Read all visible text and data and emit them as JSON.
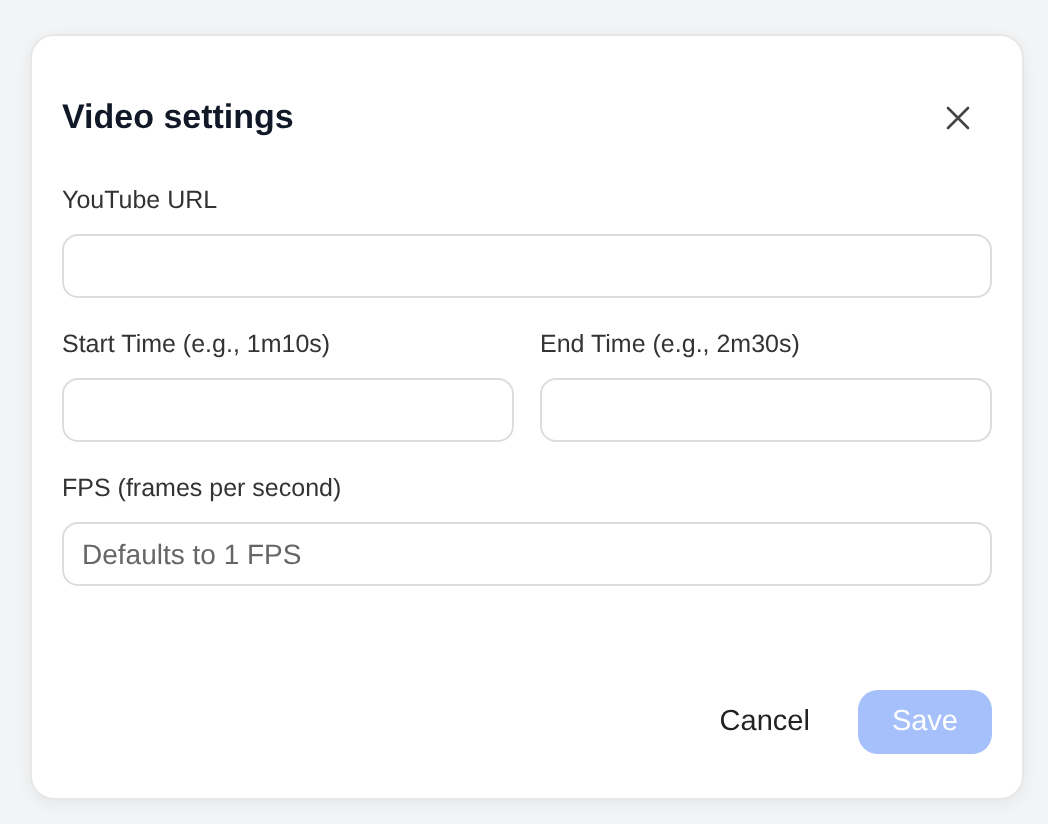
{
  "dialog": {
    "title": "Video settings",
    "rows": [
      [
        {
          "label": "YouTube URL"
        }
      ],
      [
        {
          "label": "Start Time (e.g., 1m10s)"
        },
        {
          "label": "End Time (e.g., 2m30s)"
        }
      ],
      [
        {
          "label": "FPS (frames per second)",
          "placeholder": "Defaults to 1 FPS"
        }
      ]
    ],
    "buttons": [
      {
        "label": "Cancel",
        "kind": "secondary",
        "disabled": false
      },
      {
        "label": "Save",
        "kind": "primary",
        "disabled": true
      }
    ]
  }
}
